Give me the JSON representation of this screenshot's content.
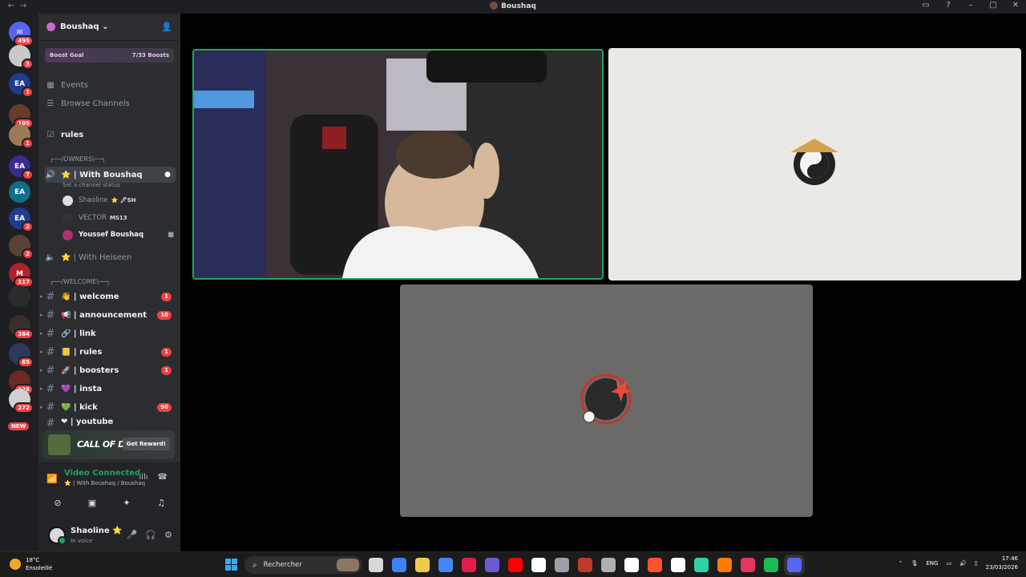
{
  "window": {
    "title": "Boushaq"
  },
  "server_list": {
    "servers": [
      {
        "name": "discord-home",
        "badge": "495",
        "color": "#5865f2",
        "glyph": "✉"
      },
      {
        "name": "server-2",
        "badge": "3",
        "color": "#c9c9c9",
        "glyph": ""
      },
      {
        "name": "ea-server-1",
        "badge": "1",
        "color": "#1f3c8f",
        "glyph": "EA"
      },
      {
        "name": "server-4",
        "badge": "105",
        "color": "#6a3b2b",
        "glyph": ""
      },
      {
        "name": "server-5",
        "badge": "1",
        "color": "#9a7b55",
        "glyph": ""
      },
      {
        "name": "ea-server-2",
        "badge": "7",
        "color": "#3b2a8f",
        "glyph": "EA"
      },
      {
        "name": "ea-server-3",
        "badge": "",
        "color": "#0f6f8a",
        "glyph": "EA"
      },
      {
        "name": "ea-server-4",
        "badge": "2",
        "color": "#1f3c8f",
        "glyph": "EA"
      },
      {
        "name": "server-9",
        "badge": "2",
        "color": "#5a4038",
        "glyph": ""
      },
      {
        "name": "server-10",
        "badge": "117",
        "color": "#b0222a",
        "glyph": "M"
      },
      {
        "name": "server-11",
        "badge": "",
        "color": "#2c2c2c",
        "glyph": ""
      },
      {
        "name": "server-12",
        "badge": "384",
        "color": "#3a2d2d",
        "glyph": ""
      },
      {
        "name": "server-13",
        "badge": "65",
        "color": "#2d3a5a",
        "glyph": ""
      },
      {
        "name": "server-14",
        "badge": "128",
        "color": "#6a2a22",
        "glyph": ""
      },
      {
        "name": "server-15",
        "badge": "272",
        "color": "#d0d0d0",
        "glyph": ""
      }
    ],
    "new_label": "NEW"
  },
  "guild": {
    "name": "Boushaq",
    "boost_goal_label": "Boost Goal",
    "boost_goal_value": "7/33 Boosts",
    "events_label": "Events",
    "browse_label": "Browse Channels",
    "rules_top": "rules",
    "owners_category": "┌──/OWNERS\\──┐",
    "with_boushaq": "⭐ | With Boushaq",
    "channel_status": "Set a channel status",
    "voice_users": [
      {
        "name": "Shaoline",
        "tag": "⭐  🖊SH",
        "avatar": "#dddddd"
      },
      {
        "name": "VECTOR",
        "tag": "MS13",
        "avatar": "#333333"
      },
      {
        "name": "Youssef Boushaq",
        "tag": "",
        "avatar": "#b0306a"
      }
    ],
    "with_heiseen": "⭐ | With Heiseen",
    "welcome_category": "┌──/WELCOME\\──┐",
    "text_channels": [
      {
        "label": "👋 | welcome",
        "count": "1"
      },
      {
        "label": "📢 | announcement",
        "count": "10"
      },
      {
        "label": "🔗 | link",
        "count": ""
      },
      {
        "label": "📒 | rules",
        "count": "1"
      },
      {
        "label": "🚀 | boosters",
        "count": "1"
      },
      {
        "label": "💜 | insta",
        "count": ""
      },
      {
        "label": "💚 | kick",
        "count": "90"
      },
      {
        "label": "❤ | youtube",
        "count": ""
      }
    ]
  },
  "promo": {
    "title": "CALL OF DUTY",
    "button": "Get Reward!"
  },
  "voice_status": {
    "title": "Video Connected",
    "subtitle": "⭐ | With Boushaq / Boushaq"
  },
  "user_panel": {
    "name": "Shaoline ⭐",
    "status": "In voice"
  },
  "taskbar": {
    "temperature": "18°C",
    "weather": "Ensoleillé",
    "search_placeholder": "Rechercher",
    "language": "ENG",
    "time": "17:46",
    "date": "23/03/2026",
    "app_colors": [
      "#d9d9d9",
      "#3b82f6",
      "#f2c94c",
      "#4285f4",
      "#e11d48",
      "#6b5bd2",
      "#ff0000",
      "#ffffff",
      "#9aa0a6",
      "#c0392b",
      "#b0b0b0",
      "#ffffff",
      "#fb542b",
      "#ffffff",
      "#2fd3a3",
      "#ff7a00",
      "#e5345f",
      "#1db954",
      "#5865f2"
    ]
  }
}
